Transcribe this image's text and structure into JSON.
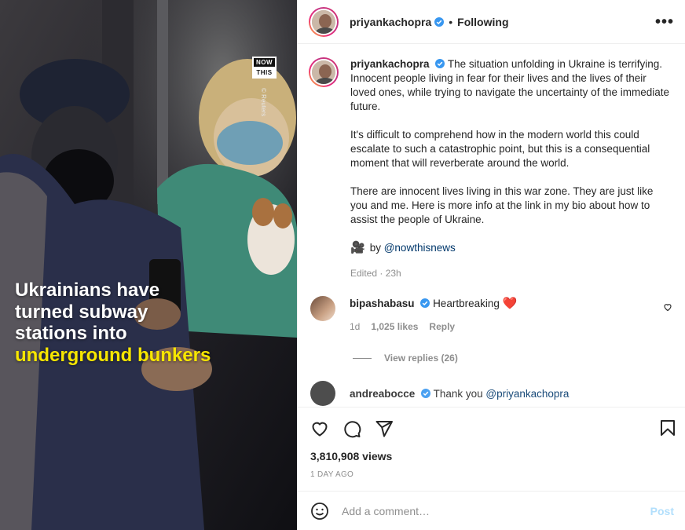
{
  "post": {
    "username": "priyankachopra",
    "following": "Following",
    "separator": "•",
    "more": "•••"
  },
  "media": {
    "brand_top": "NOW",
    "brand_bottom": "THIS",
    "credit": "© Reuters",
    "headline_line1": "Ukrainians have",
    "headline_line2": "turned subway",
    "headline_line3": "stations into",
    "headline_highlight": "underground bunkers"
  },
  "caption": {
    "username": "priyankachopra",
    "para1": "The situation unfolding in Ukraine is terrifying. Innocent people living in fear for their lives and the lives of their loved ones, while trying to navigate the uncertainty of the immediate future.",
    "para2": "It's difficult to comprehend how in the modern world this could escalate to such a catastrophic point, but this is a consequential moment that will reverberate around the world.",
    "para3": "There are innocent lives living in this war zone. They are just like you and me. Here is more info at the link in my bio about how to assist the people of Ukraine.",
    "by_prefix": "by",
    "by_link": "@nowthisnews",
    "edited": "Edited · 23h"
  },
  "comments": [
    {
      "username": "bipashabasu",
      "text": "Heartbreaking",
      "time": "1d",
      "likes": "1,025 likes",
      "reply": "Reply",
      "view_replies": "View replies (26)"
    },
    {
      "username": "andreabocce",
      "text": "Thank you",
      "mention": "@priyankachopra"
    }
  ],
  "stats": {
    "views": "3,810,908 views",
    "ago": "1 DAY AGO"
  },
  "comment_box": {
    "placeholder": "Add a comment…",
    "post_label": "Post"
  },
  "colors": {
    "link": "#00376b",
    "verified": "#3897f0",
    "highlight": "#f7e600",
    "post_disabled": "#b2dffc"
  }
}
